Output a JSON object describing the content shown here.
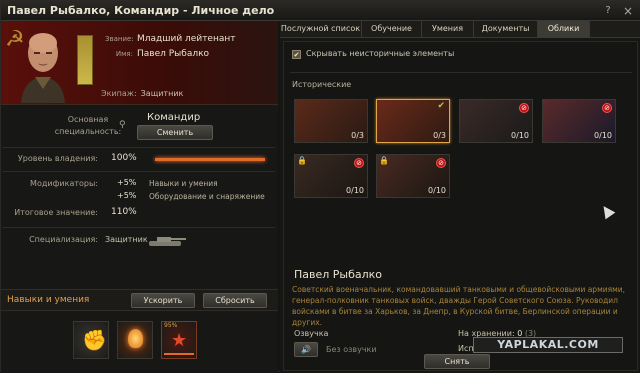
{
  "window": {
    "title": "Павел Рыбалко, Командир - Личное дело",
    "help_icon": "?",
    "close_icon": "×"
  },
  "hero": {
    "rank_label": "Звание:",
    "rank_value": "Младший лейтенант",
    "name_label": "Имя:",
    "name_value": "Павел Рыбалко",
    "crew_label": "Экипаж:",
    "crew_value": "Защитник"
  },
  "specialty": {
    "label1": "Основная",
    "label2": "специальность:",
    "value": "Командир",
    "change_button": "Сменить"
  },
  "mastery": {
    "label": "Уровень владения:",
    "value": "100%",
    "fill_percent": 100
  },
  "modifiers": {
    "label": "Модификаторы:",
    "rows": [
      {
        "value": "+5%",
        "text": "Навыки и умения"
      },
      {
        "value": "+5%",
        "text": "Оборудование и снаряжение"
      }
    ]
  },
  "total": {
    "label": "Итоговое значение:",
    "value": "110%"
  },
  "specialization": {
    "label": "Специализация:",
    "value": "Защитник"
  },
  "skills": {
    "title": "Навыки и умения",
    "accelerate_button": "Ускорить",
    "reset_button": "Сбросить",
    "progress_badge": "95%"
  },
  "tabs": [
    {
      "label": "Послужной список"
    },
    {
      "label": "Обучение"
    },
    {
      "label": "Умения"
    },
    {
      "label": "Документы"
    },
    {
      "label": "Облики",
      "active": true
    }
  ],
  "looks": {
    "hide_label": "Скрывать неисторичные элементы",
    "hide_checked": true,
    "section": "Исторические",
    "cards": [
      {
        "count": "0/3",
        "banned": false,
        "selected": false,
        "owned": false
      },
      {
        "count": "0/3",
        "banned": false,
        "selected": true,
        "owned": true
      },
      {
        "count": "0/10",
        "banned": true,
        "selected": false,
        "owned": false
      },
      {
        "count": "0/10",
        "banned": true,
        "selected": false,
        "owned": false
      },
      {
        "count": "0/10",
        "banned": true,
        "selected": false,
        "owned": false
      },
      {
        "count": "0/10",
        "banned": true,
        "selected": false,
        "owned": false
      }
    ]
  },
  "details": {
    "name": "Павел Рыбалко",
    "description": "Советский военачальник, командовавший танковыми и общевойсковыми армиями, генерал-полковник танковых войск, дважды Герой Советского Союза. Руководил войсками в битве за Харьков, за Днепр, в Курской битве, Берлинской операции и других.",
    "voice_label": "Озвучка",
    "voice_value": "Без озвучки",
    "storage_label": "На хранении:",
    "storage_value": "0",
    "storage_extra": "(3)",
    "used_label": "Используется:",
    "used_value": "1",
    "remove_button": "Снять"
  },
  "watermark": "YAPLAKAL.COM",
  "colors": {
    "accent": "#e2a64a",
    "bar": "#e36a2a",
    "text_gold": "#a8843a"
  }
}
